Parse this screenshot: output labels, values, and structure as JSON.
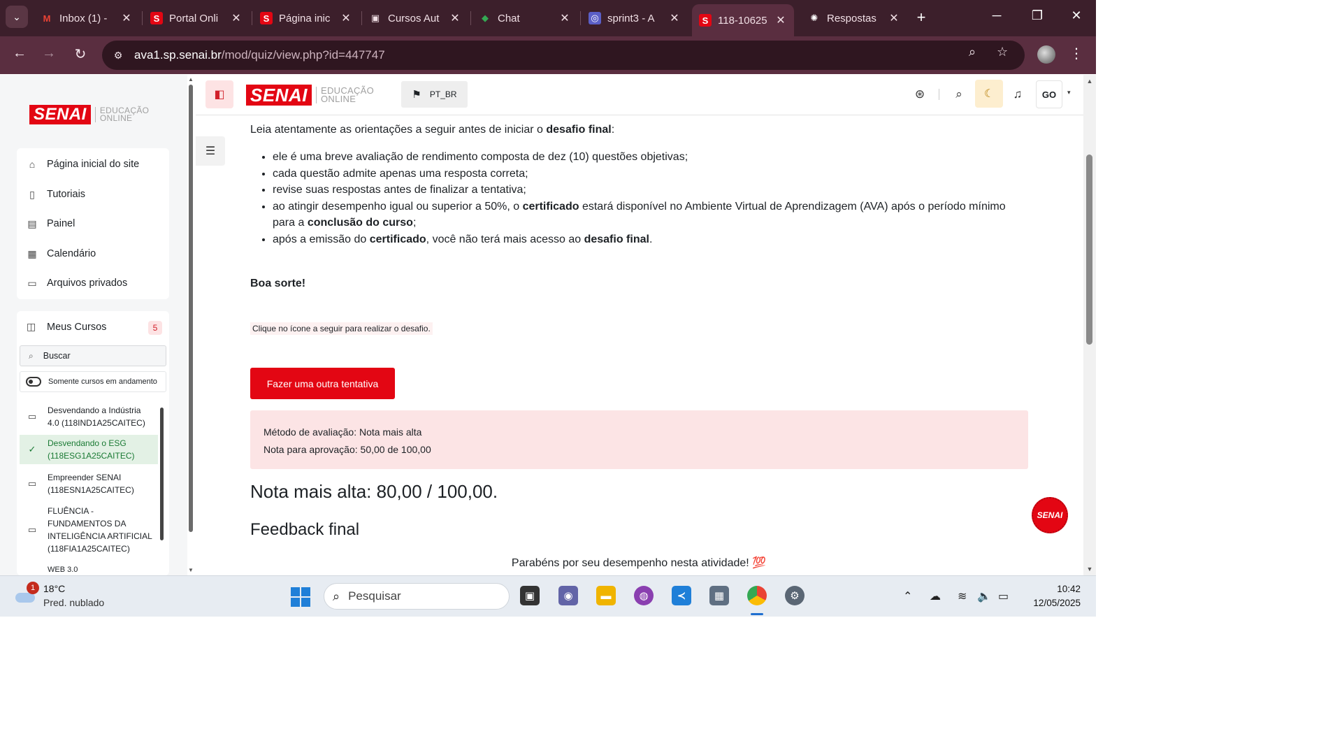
{
  "browser": {
    "tabs": [
      {
        "title": "Inbox (1) -",
        "favicon": "M",
        "favicon_color": "#ea4335",
        "favicon_bg": "transparent"
      },
      {
        "title": "Portal Onli",
        "favicon": "S",
        "favicon_color": "#ffffff",
        "favicon_bg": "#e30613"
      },
      {
        "title": "Página inic",
        "favicon": "S",
        "favicon_color": "#ffffff",
        "favicon_bg": "#e30613"
      },
      {
        "title": "Cursos Aut",
        "favicon": "▣",
        "favicon_color": "#f1dfe5",
        "favicon_bg": "transparent"
      },
      {
        "title": "Chat",
        "favicon": "◆",
        "favicon_color": "#34a853",
        "favicon_bg": "transparent"
      },
      {
        "title": "sprint3 - A",
        "favicon": "◎",
        "favicon_color": "#ffffff",
        "favicon_bg": "#5b5fc7"
      },
      {
        "title": "118-10625",
        "favicon": "S",
        "favicon_color": "#ffffff",
        "favicon_bg": "#e30613",
        "active": true
      },
      {
        "title": "Respostas",
        "favicon": "✺",
        "favicon_color": "#ffffff",
        "favicon_bg": "transparent"
      }
    ],
    "url_host": "ava1.sp.senai.br",
    "url_path": "/mod/quiz/view.php?id=447747"
  },
  "drawer": {
    "logo_word": "SENAI",
    "logo_tagline_1": "EDUCAÇÃO",
    "logo_tagline_2": "ONLINE",
    "nav": [
      {
        "label": "Página inicial do site",
        "icon": "home-icon"
      },
      {
        "label": "Tutoriais",
        "icon": "book-icon"
      },
      {
        "label": "Painel",
        "icon": "dashboard-icon"
      },
      {
        "label": "Calendário",
        "icon": "calendar-icon"
      },
      {
        "label": "Arquivos privados",
        "icon": "inbox-icon"
      }
    ],
    "my_courses_label": "Meus Cursos",
    "my_courses_count": "5",
    "search_placeholder": "Buscar",
    "toggle_label": "Somente cursos em andamento",
    "courses": [
      {
        "line1": "Desvendando a Indústria",
        "line2": "4.0 (118IND1A25CAITEC)"
      },
      {
        "line1": "Desvendando o ESG",
        "line2": "(118ESG1A25CAITEC)",
        "selected": true
      },
      {
        "line1": "Empreender SENAI",
        "line2": "(118ESN1A25CAITEC)"
      },
      {
        "line1": "FLUÊNCIA -",
        "line2": "FUNDAMENTOS DA",
        "line3": "INTELIGÊNCIA ARTIFICIAL",
        "line4": "(118FIA1A25CAITEC)"
      },
      {
        "line1": "WEB 3.0"
      }
    ]
  },
  "header": {
    "language": "PT_BR",
    "user_initials": "GO"
  },
  "main": {
    "intro_pre": "Leia atentamente as orientações a seguir antes de iniciar o ",
    "intro_bold": "desafio final",
    "intro_post": ":",
    "bullet1": "ele é uma breve avaliação de rendimento composta de dez (10) questões objetivas;",
    "bullet2": "cada questão admite apenas uma resposta correta;",
    "bullet3": "revise suas respostas antes de finalizar a tentativa;",
    "bullet4_a": "ao atingir desempenho igual ou superior a 50%, o ",
    "bullet4_b": "certificado",
    "bullet4_c": " estará disponível no Ambiente Virtual de Aprendizagem (AVA) após o período mínimo para a ",
    "bullet4_d": "conclusão do curso",
    "bullet4_e": ";",
    "bullet5_a": "após a emissão do ",
    "bullet5_b": "certificado",
    "bullet5_c": ", você não terá mais acesso ao ",
    "bullet5_d": "desafio final",
    "bullet5_e": ".",
    "good_luck": "Boa sorte!",
    "hint": "Clique no ícone a seguir para realizar o desafio.",
    "attempt_button": "Fazer uma outra tentativa",
    "method_line": "Método de avaliação: Nota mais alta",
    "pass_line": "Nota para aprovação: 50,00 de 100,00",
    "highest_grade": "Nota mais alta: 80,00 / 100,00.",
    "feedback_heading": "Feedback final",
    "feedback_text": "Parabéns por seu desempenho nesta atividade! 💯",
    "floating_badge": "SENAI"
  },
  "taskbar": {
    "weather_badge": "1",
    "temperature": "18°C",
    "weather_desc": "Pred. nublado",
    "search_placeholder": "Pesquisar",
    "time": "10:42",
    "date": "12/05/2025"
  },
  "colors": {
    "brand_red": "#e30613",
    "tab_strip": "#3c1f2b",
    "toolbar": "#5a2e40",
    "info_box": "#fce4e5"
  }
}
